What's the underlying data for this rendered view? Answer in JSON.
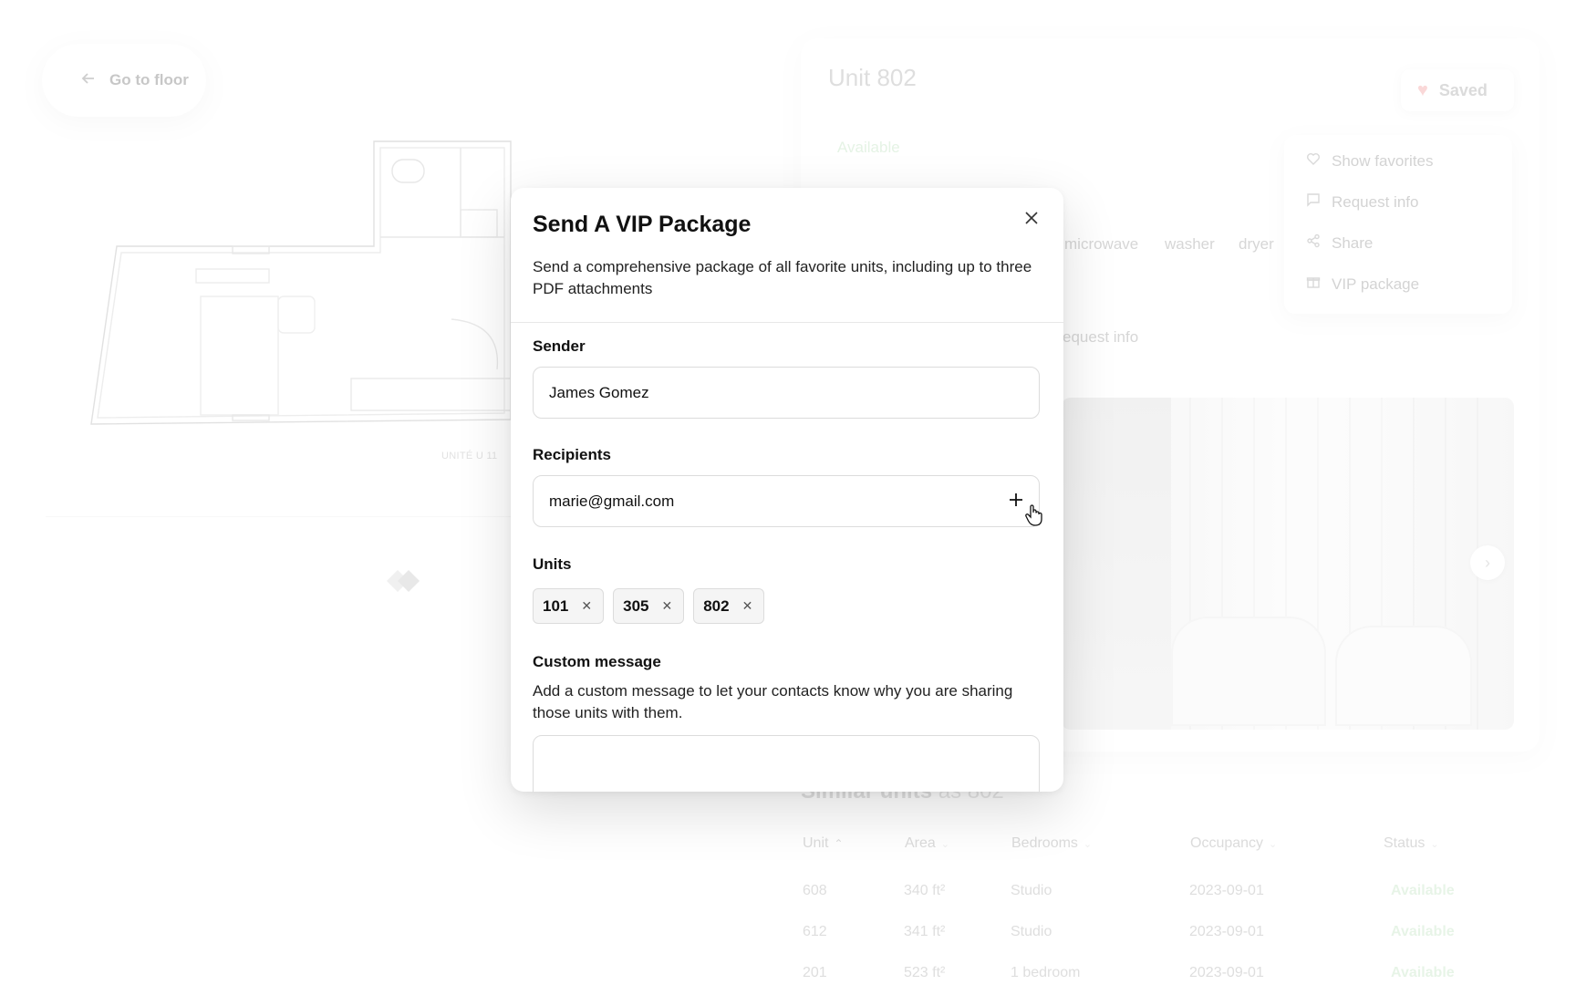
{
  "background": {
    "back_label": "Go to floor",
    "floorplan_caption": "UNITÉ U 11",
    "unit_title": "Unit 802",
    "saved_label": "Saved",
    "status": "Available",
    "amenities": [
      "microwave",
      "washer",
      "dryer"
    ],
    "request_info_partial": "equest info",
    "actions_menu": [
      {
        "label": "Show favorites",
        "icon": "heart-icon"
      },
      {
        "label": "Request info",
        "icon": "message-icon"
      },
      {
        "label": "Share",
        "icon": "share-icon"
      },
      {
        "label": "VIP package",
        "icon": "gift-icon"
      }
    ],
    "similar_title_bold": "Similar units",
    "similar_title_muted": "as 802",
    "table": {
      "headers": [
        "Unit",
        "Area",
        "Bedrooms",
        "Occupancy",
        "Status"
      ],
      "rows": [
        [
          "608",
          "340 ft²",
          "Studio",
          "2023-09-01",
          "Available"
        ],
        [
          "612",
          "341 ft²",
          "Studio",
          "2023-09-01",
          "Available"
        ],
        [
          "201",
          "523 ft²",
          "1 bedroom",
          "2023-09-01",
          "Available"
        ]
      ]
    },
    "colors": {
      "available_green": "#cfe9cf",
      "saved_heart": "#f6b9b9"
    }
  },
  "modal": {
    "title": "Send A VIP Package",
    "description": "Send a comprehensive package of all favorite units, including up to three PDF attachments",
    "sender": {
      "label": "Sender",
      "value": "James Gomez"
    },
    "recipients": {
      "label": "Recipients",
      "value": "marie@gmail.com"
    },
    "units": {
      "label": "Units",
      "chips": [
        "101",
        "305",
        "802"
      ]
    },
    "custom_message": {
      "label": "Custom message",
      "description": "Add a custom message to let your contacts know why you are sharing those units with them.",
      "value": ""
    }
  }
}
